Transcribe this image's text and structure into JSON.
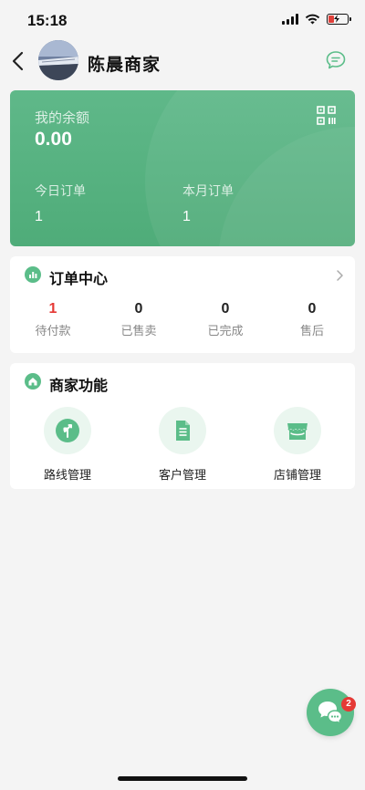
{
  "status_bar": {
    "time": "15:18"
  },
  "header": {
    "shop_name": "陈晨商家",
    "avatar_icon": "avatar-photo",
    "back_icon": "chevron-left-icon",
    "message_icon": "chat-bubble-icon"
  },
  "balance_card": {
    "balance_label": "我的余额",
    "balance_value": "0.00",
    "qr_icon": "qr-code-icon",
    "today_orders_label": "今日订单",
    "today_orders_value": "1",
    "month_orders_label": "本月订单",
    "month_orders_value": "1",
    "accent_color": "#55b17f"
  },
  "order_center": {
    "title": "订单中心",
    "title_icon": "bar-chart-icon",
    "items": [
      {
        "count": "1",
        "label": "待付款",
        "color": "#e53935"
      },
      {
        "count": "0",
        "label": "已售卖"
      },
      {
        "count": "0",
        "label": "已完成"
      },
      {
        "count": "0",
        "label": "售后"
      }
    ]
  },
  "merchant_functions": {
    "title": "商家功能",
    "title_icon": "home-icon",
    "items": [
      {
        "label": "路线管理",
        "icon": "route-icon"
      },
      {
        "label": "客户管理",
        "icon": "document-icon"
      },
      {
        "label": "店铺管理",
        "icon": "store-icon"
      }
    ]
  },
  "floating_chat": {
    "icon": "chat-bubbles-icon",
    "badge": "2"
  }
}
